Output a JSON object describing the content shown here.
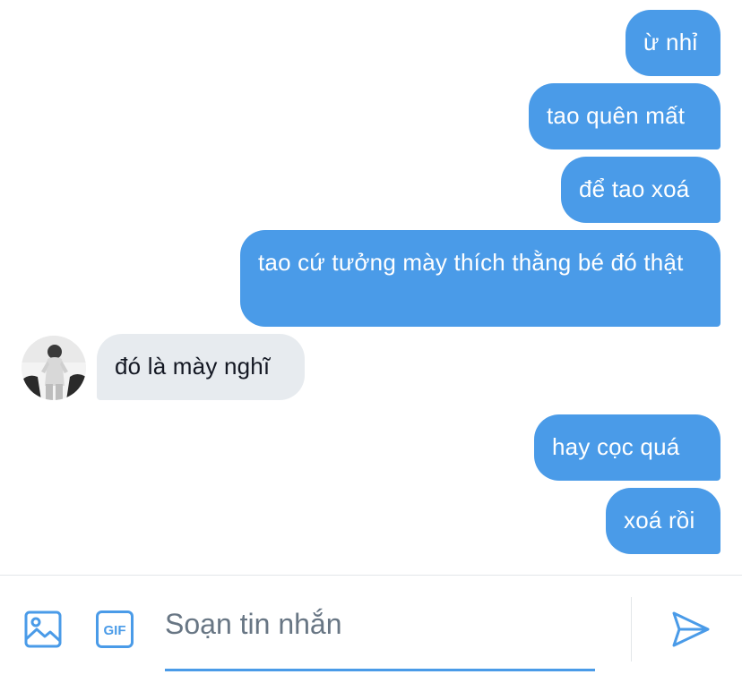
{
  "colors": {
    "accent": "#4a9be8",
    "received_bubble": "#e7ebef",
    "sent_text": "#ffffff",
    "received_text": "#141823"
  },
  "messages": [
    {
      "direction": "sent",
      "text": "ừ nhỉ"
    },
    {
      "direction": "sent",
      "text": "tao quên mất"
    },
    {
      "direction": "sent",
      "text": "để tao xoá"
    },
    {
      "direction": "sent",
      "text": "tao cứ tưởng mày thích thằng bé đó thật"
    },
    {
      "direction": "received",
      "text": "đó là mày nghĩ"
    },
    {
      "direction": "sent",
      "text": "hay cọc quá"
    },
    {
      "direction": "sent",
      "text": "xoá rồi"
    }
  ],
  "composer": {
    "placeholder": "Soạn tin nhắn",
    "value": "",
    "image_icon": "image-icon",
    "gif_icon": "gif-icon",
    "gif_label": "GIF",
    "send_icon": "send-icon"
  },
  "contact": {
    "avatar_icon": "avatar"
  }
}
